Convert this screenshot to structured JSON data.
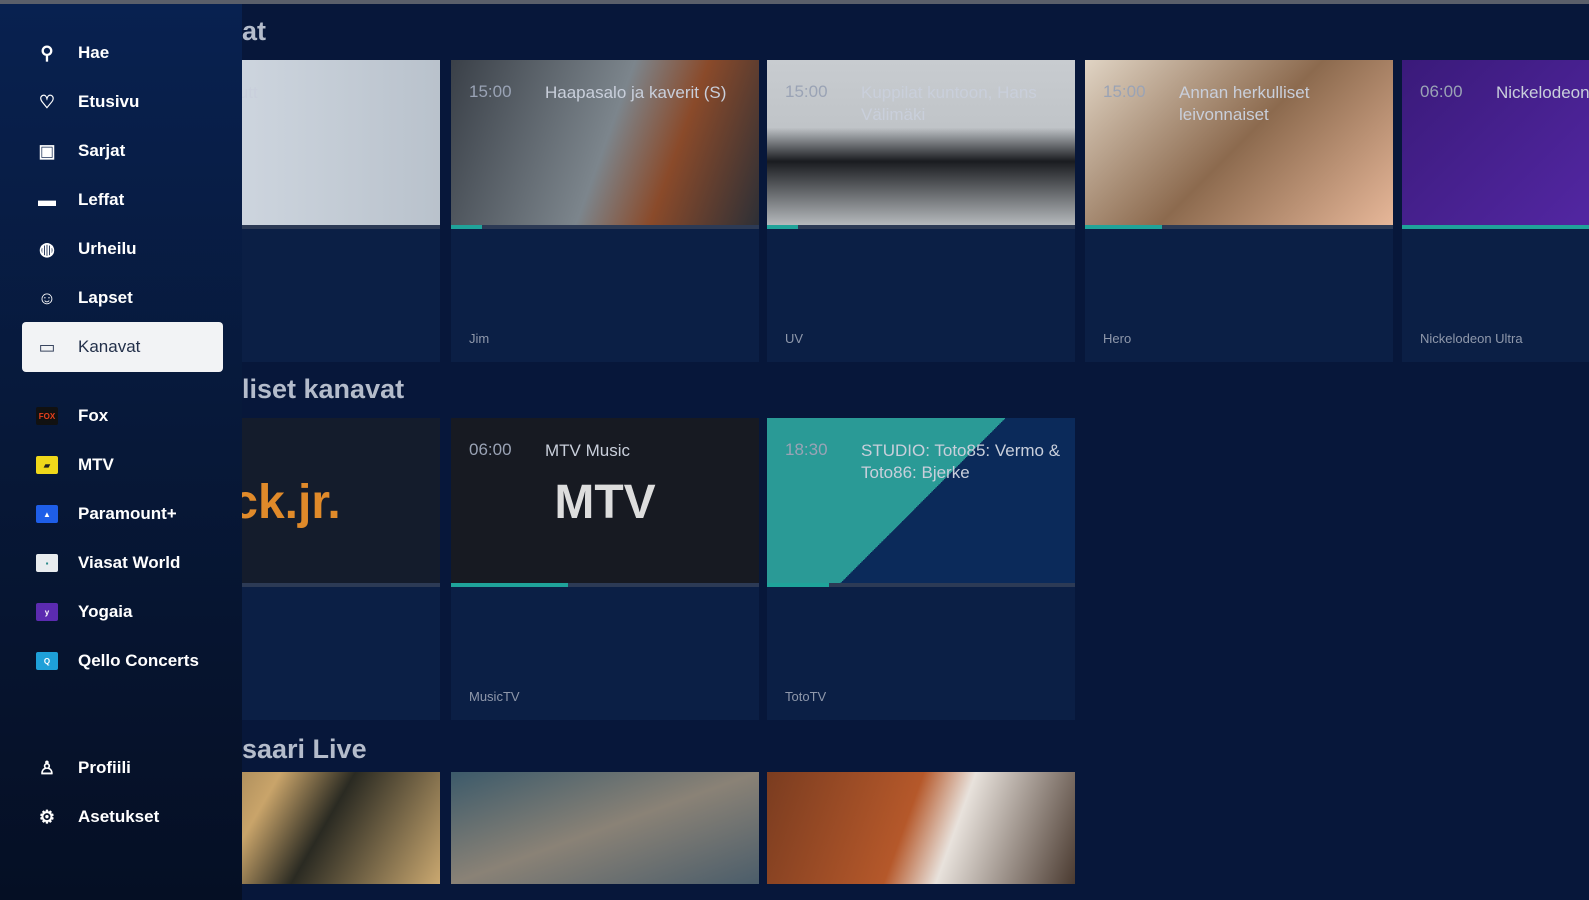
{
  "sidebar": {
    "items": [
      {
        "label": "Hae",
        "icon": "search-icon",
        "glyph": "⚲"
      },
      {
        "label": "Etusivu",
        "icon": "heart-icon",
        "glyph": "♡"
      },
      {
        "label": "Sarjat",
        "icon": "series-icon",
        "glyph": "▣"
      },
      {
        "label": "Leffat",
        "icon": "movie-icon",
        "glyph": "▬"
      },
      {
        "label": "Urheilu",
        "icon": "sports-ball-icon",
        "glyph": "◍"
      },
      {
        "label": "Lapset",
        "icon": "kids-icon",
        "glyph": "☺"
      },
      {
        "label": "Kanavat",
        "icon": "tv-icon",
        "glyph": "▭"
      }
    ],
    "channels": [
      {
        "label": "Fox",
        "logo": "FOX",
        "color": "#111",
        "fg": "#e8401c"
      },
      {
        "label": "MTV",
        "logo": "▰",
        "color": "#f0d81a",
        "fg": "#222"
      },
      {
        "label": "Paramount+",
        "logo": "▲",
        "color": "#1e5ee8",
        "fg": "#fff"
      },
      {
        "label": "Viasat World",
        "logo": "▪",
        "color": "#e8ecef",
        "fg": "#2a8a8a"
      },
      {
        "label": "Yogaia",
        "logo": "y",
        "color": "#5b2bb0",
        "fg": "#fff"
      },
      {
        "label": "Qello Concerts",
        "logo": "Q",
        "color": "#1ea0d8",
        "fg": "#fff"
      }
    ],
    "bottom": [
      {
        "label": "Profiili",
        "icon": "profile-icon",
        "glyph": "♙"
      },
      {
        "label": "Asetukset",
        "icon": "settings-gear-icon",
        "glyph": "⚙"
      }
    ]
  },
  "sections": [
    {
      "heading": "at",
      "cards": [
        {
          "time": "",
          "title": "emppa vai muutt Vancouver",
          "channel": "",
          "progress": 0
        },
        {
          "time": "15:00",
          "title": "Haapasalo ja kaverit (S)",
          "channel": "Jim",
          "progress": 0.1
        },
        {
          "time": "15:00",
          "title": "Kuppilat kuntoon, Hans Välimäki",
          "channel": "UV",
          "progress": 0.1
        },
        {
          "time": "15:00",
          "title": "Annan herkulliset leivonnaiset",
          "channel": "Hero",
          "progress": 0.25
        },
        {
          "time": "06:00",
          "title": "Nickelodeon Plus",
          "channel": "Nickelodeon Ultra",
          "progress": 0.75
        }
      ]
    },
    {
      "heading": "liset kanavat",
      "cards": [
        {
          "time": "",
          "title": "Nick Jr.",
          "channel": "",
          "progress": 0,
          "logo": "ck.jr."
        },
        {
          "time": "06:00",
          "title": "MTV Music",
          "channel": "MusicTV",
          "progress": 0.38,
          "logo": "MTV"
        },
        {
          "time": "18:30",
          "title": "STUDIO: Toto85: Vermo & Toto86: Bjerke",
          "channel": "TotoTV",
          "progress": 0.2,
          "logo": ""
        }
      ]
    },
    {
      "heading": "saari Live"
    }
  ]
}
